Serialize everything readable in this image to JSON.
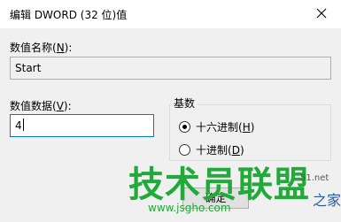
{
  "dialog": {
    "title": "编辑 DWORD (32 位)值"
  },
  "value_name": {
    "label_prefix": "数值名称(",
    "label_hotkey": "N",
    "label_suffix": "):",
    "value": "Start"
  },
  "value_data": {
    "label_prefix": "数值数据(",
    "label_hotkey": "V",
    "label_suffix": "):",
    "value": "4"
  },
  "base": {
    "title": "基数",
    "options": [
      {
        "label_prefix": "十六进制(",
        "hotkey": "H",
        "label_suffix": ")",
        "checked": true
      },
      {
        "label_prefix": "十进制(",
        "hotkey": "D",
        "label_suffix": ")",
        "checked": false
      }
    ]
  },
  "buttons": {
    "ok_label": "确定"
  },
  "watermark": {
    "text": "技术员联盟",
    "url": "www.jsgho.com",
    "corner_text": "之家",
    "corner_number": "51.net"
  }
}
